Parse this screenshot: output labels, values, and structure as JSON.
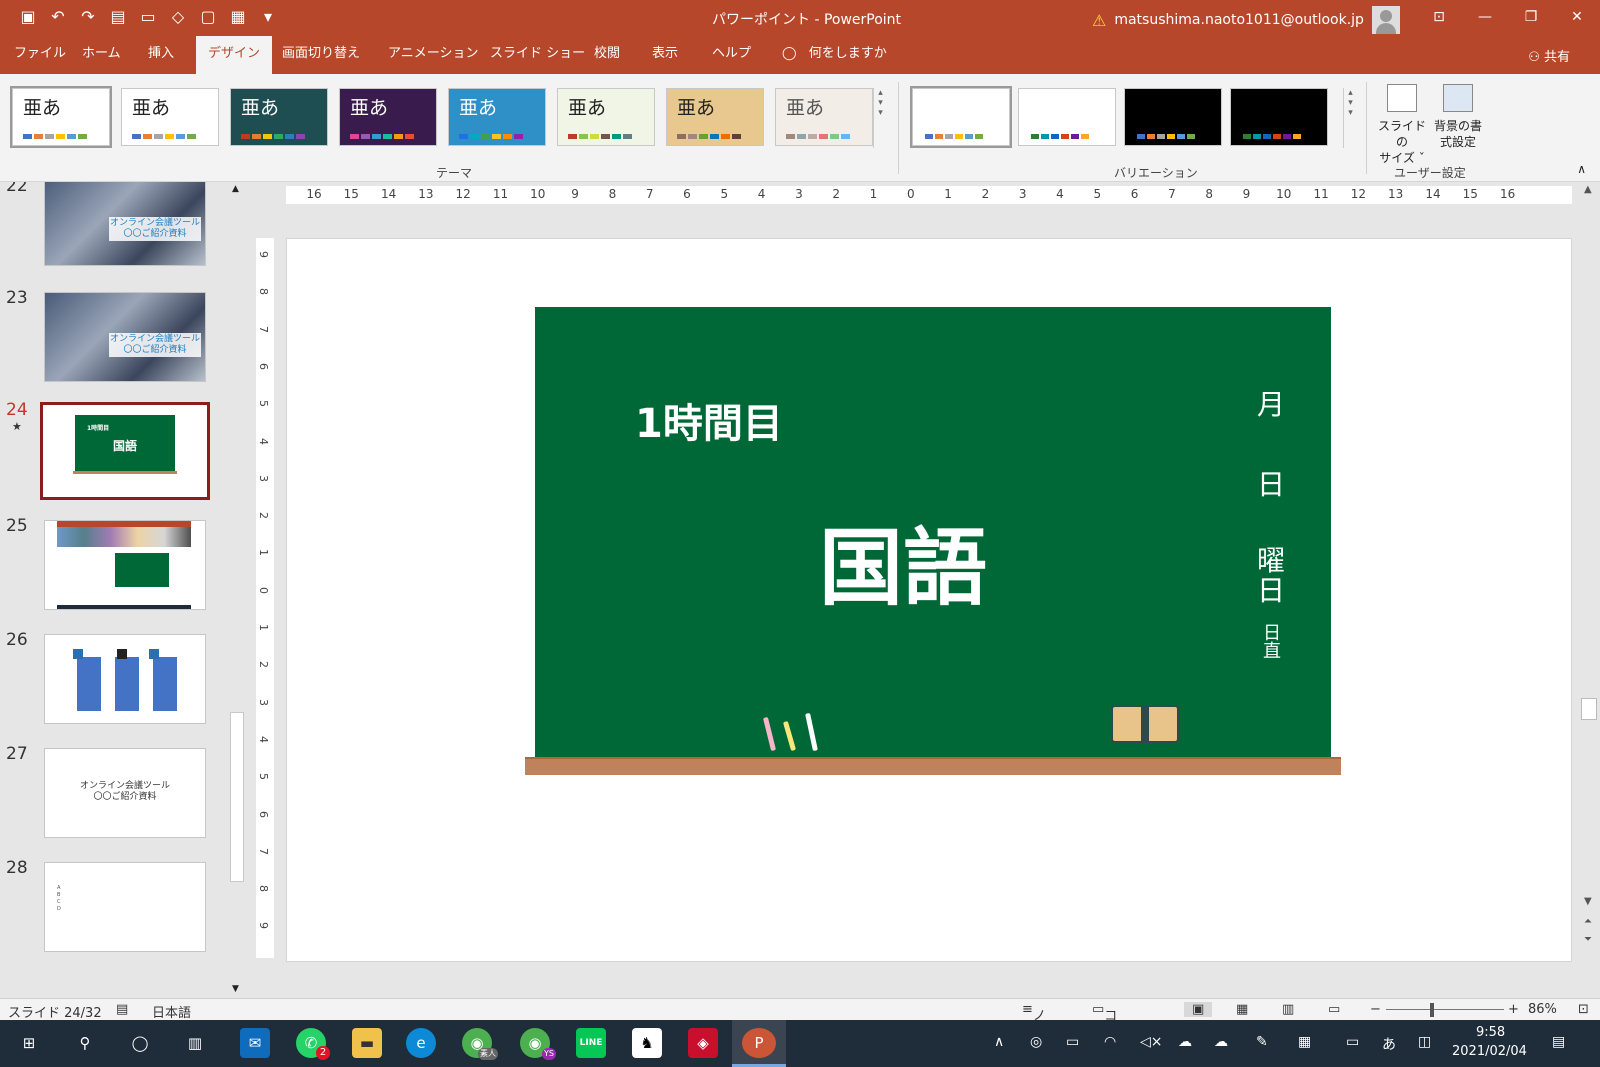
{
  "titlebar": {
    "title": "パワーポイント  -  PowerPoint",
    "account": "matsushima.naoto1011@outlook.jp",
    "warning_icon": "warning-icon",
    "window_buttons": [
      "ribbon-display-icon",
      "minimize-icon",
      "restore-icon",
      "close-icon"
    ]
  },
  "menu": {
    "tabs": [
      "ファイル",
      "ホーム",
      "挿入",
      "デザイン",
      "画面切り替え",
      "アニメーション",
      "スライド ショー",
      "校閲",
      "表示",
      "ヘルプ"
    ],
    "active_tab": "デザイン",
    "tell_me": "何をしますか",
    "share": "共有"
  },
  "ribbon": {
    "themes_group": "テーマ",
    "themes": [
      {
        "label": "亜あ",
        "bg": "#ffffff",
        "fg": "#222222",
        "colors": [
          "#4472c4",
          "#ed7d31",
          "#a5a5a5",
          "#ffc000",
          "#5b9bd5",
          "#70ad47"
        ]
      },
      {
        "label": "亜あ",
        "bg": "#ffffff",
        "fg": "#222222",
        "colors": [
          "#4472c4",
          "#ed7d31",
          "#a5a5a5",
          "#ffc000",
          "#5b9bd5",
          "#70ad47"
        ]
      },
      {
        "label": "亜あ",
        "bg": "#1e4d52",
        "fg": "#ffffff",
        "colors": [
          "#c0392b",
          "#e67e22",
          "#f1c40f",
          "#27ae60",
          "#2980b9",
          "#8e44ad"
        ]
      },
      {
        "label": "亜あ",
        "bg": "#3a1b4e",
        "fg": "#ffffff",
        "colors": [
          "#e84393",
          "#9b59b6",
          "#3498db",
          "#1abc9c",
          "#f39c12",
          "#e74c3c"
        ]
      },
      {
        "label": "亜あ",
        "bg": "#2f8fc7",
        "fg": "#ffffff",
        "colors": [
          "#1a73e8",
          "#00acc1",
          "#43a047",
          "#fbc02d",
          "#fb8c00",
          "#8e24aa"
        ]
      },
      {
        "label": "亜あ",
        "bg": "#f1f5e6",
        "fg": "#222222",
        "colors": [
          "#c0392b",
          "#8bc34a",
          "#cddc39",
          "#795548",
          "#009688",
          "#607d8b"
        ]
      },
      {
        "label": "亜あ",
        "bg": "#e8c88f",
        "fg": "#222222",
        "colors": [
          "#8d6e63",
          "#a1887f",
          "#689f38",
          "#0277bd",
          "#ef6c00",
          "#5d4037"
        ]
      },
      {
        "label": "亜あ",
        "bg": "#f2ede7",
        "fg": "#555555",
        "colors": [
          "#a1887f",
          "#90a4ae",
          "#bcaaa4",
          "#e57373",
          "#81c784",
          "#64b5f6"
        ]
      }
    ],
    "variations_group": "バリエーション",
    "variations": [
      {
        "bg": "#ffffff",
        "colors": [
          "#4472c4",
          "#ed7d31",
          "#a5a5a5",
          "#ffc000",
          "#5b9bd5",
          "#70ad47"
        ]
      },
      {
        "bg": "#ffffff",
        "colors": [
          "#2e7d32",
          "#0097a7",
          "#1565c0",
          "#d84315",
          "#6a1b9a",
          "#f9a825"
        ]
      },
      {
        "bg": "#000000",
        "colors": [
          "#4472c4",
          "#ed7d31",
          "#a5a5a5",
          "#ffc000",
          "#5b9bd5",
          "#70ad47"
        ]
      },
      {
        "bg": "#000000",
        "colors": [
          "#2e7d32",
          "#0097a7",
          "#1565c0",
          "#d84315",
          "#6a1b9a",
          "#f9a825"
        ]
      }
    ],
    "custom_group": "ユーザー設定",
    "slide_size_line1": "スライドの",
    "slide_size_line2": "サイズ ˇ",
    "bg_format_line1": "背景の書",
    "bg_format_line2": "式設定"
  },
  "thumbnails": [
    {
      "num": "22",
      "caption_1": "オンライン会議ツール",
      "caption_2": "〇〇ご紹介資料",
      "type": "photo"
    },
    {
      "num": "23",
      "caption_1": "オンライン会議ツール",
      "caption_2": "〇〇ご紹介資料",
      "type": "photo"
    },
    {
      "num": "24",
      "type": "board",
      "selected": true,
      "star": "★"
    },
    {
      "num": "25",
      "type": "screenshot"
    },
    {
      "num": "26",
      "type": "bars"
    },
    {
      "num": "27",
      "caption_1": "オンライン会議ツール",
      "caption_2": "〇〇ご紹介資料",
      "type": "text"
    },
    {
      "num": "28",
      "type": "bullets",
      "bullets": [
        "A",
        "B",
        "C",
        "D"
      ]
    }
  ],
  "ruler": {
    "horizontal": [
      "16",
      "15",
      "14",
      "13",
      "12",
      "11",
      "10",
      "9",
      "8",
      "7",
      "6",
      "5",
      "4",
      "3",
      "2",
      "1",
      "0",
      "1",
      "2",
      "3",
      "4",
      "5",
      "6",
      "7",
      "8",
      "9",
      "10",
      "11",
      "12",
      "13",
      "14",
      "15",
      "16"
    ],
    "vertical": [
      "9",
      "8",
      "7",
      "6",
      "5",
      "4",
      "3",
      "2",
      "1",
      "0",
      "1",
      "2",
      "3",
      "4",
      "5",
      "6",
      "7",
      "8",
      "9"
    ]
  },
  "slide": {
    "period": "1時間目",
    "subject": "国語",
    "month": "月",
    "day": "日",
    "weekday_1": "曜",
    "weekday_2": "日",
    "duty": "日直",
    "colors": {
      "board": "#006837",
      "tray": "#c0825a",
      "eraser": "#e8c38a"
    }
  },
  "status": {
    "slide_counter": "スライド 24/32",
    "language": "日本語",
    "notes": "ノート",
    "comments": "コメント",
    "zoom": "86%"
  },
  "taskbar": {
    "time": "9:58",
    "date": "2021/02/04",
    "whatsapp_badge": "2",
    "chrome_badge_1": "素人",
    "chrome_badge_2": "YS",
    "line_label": "LINE",
    "ime": "あ"
  }
}
